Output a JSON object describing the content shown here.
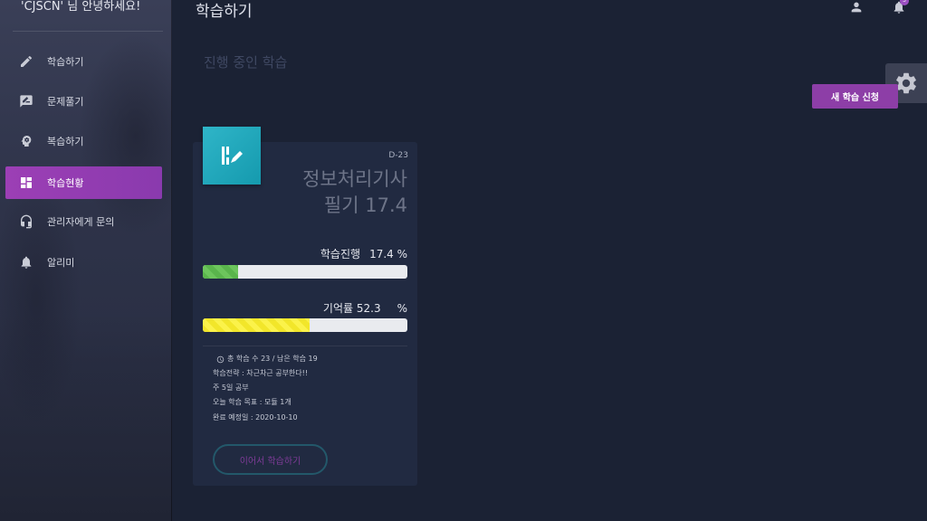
{
  "sidebar": {
    "greeting": "'CJSCN' 님 안녕하세요!",
    "items": [
      {
        "label": "학습하기",
        "icon": "pencil-icon"
      },
      {
        "label": "문제풀기",
        "icon": "quiz-icon"
      },
      {
        "label": "복습하기",
        "icon": "brain-head-icon"
      },
      {
        "label": "학습현황",
        "icon": "dashboard-icon",
        "active": true
      },
      {
        "label": "관리자에게 문의",
        "icon": "headset-icon"
      },
      {
        "label": "알리미",
        "icon": "bell-icon"
      }
    ]
  },
  "header": {
    "title": "학습하기",
    "notification_count": "3"
  },
  "main": {
    "section_title": "진행 중인 학습",
    "new_button": "새 학습 신청"
  },
  "card": {
    "dday": "D-23",
    "title_line1": "정보처리기사",
    "title_line2": "필기 17.4",
    "progress_label": "학습진행",
    "progress_value": "17.4 %",
    "progress_fraction": 0.174,
    "memory_label": "기억률",
    "memory_value": "52.3",
    "memory_unit": "%",
    "memory_fraction": 0.523,
    "info_total": "총 학습 수 23 / 남은 학습 19",
    "info_strategy": "학습전략 : 차근차근 공부한다!!",
    "info_days": "주 5일 공부",
    "info_goal": "오늘 학습 목표 : 모듈 1개",
    "info_end": "완료 예정일 : 2020-10-10",
    "continue_button": "이어서 학습하기"
  },
  "colors": {
    "accent": "#8d3ea7",
    "active_nav": "#9c3fb5",
    "progress_green": "#5ab54c",
    "memory_yellow": "#f2e62a",
    "logo_teal": "#1fa8bb"
  }
}
